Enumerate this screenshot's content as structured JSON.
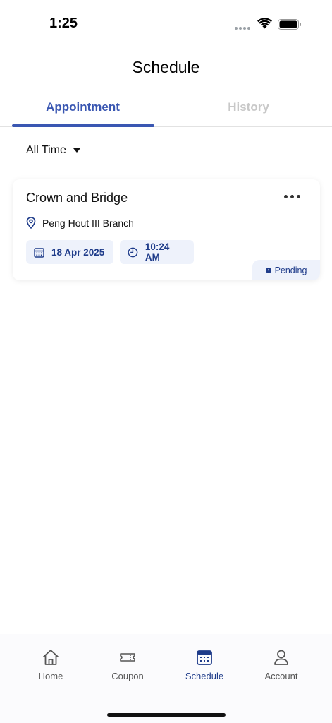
{
  "status_bar": {
    "time": "1:25"
  },
  "header": {
    "title": "Schedule"
  },
  "tabs": [
    {
      "label": "Appointment",
      "active": true
    },
    {
      "label": "History",
      "active": false
    }
  ],
  "filter": {
    "label": "All Time"
  },
  "appointments": [
    {
      "title": "Crown and Bridge",
      "branch": "Peng Hout III Branch",
      "date": "18 Apr 2025",
      "time": "10:24 AM",
      "status": "Pending"
    }
  ],
  "bottom_nav": {
    "items": [
      {
        "label": "Home",
        "icon": "home-icon"
      },
      {
        "label": "Coupon",
        "icon": "ticket-icon"
      },
      {
        "label": "Schedule",
        "icon": "calendar-icon",
        "active": true
      },
      {
        "label": "Account",
        "icon": "person-icon"
      }
    ]
  },
  "colors": {
    "accent": "#3a57b2",
    "chip_bg": "#eef2fb",
    "chip_text": "#1f3c8a",
    "inactive_tab": "#c8c8c8"
  }
}
